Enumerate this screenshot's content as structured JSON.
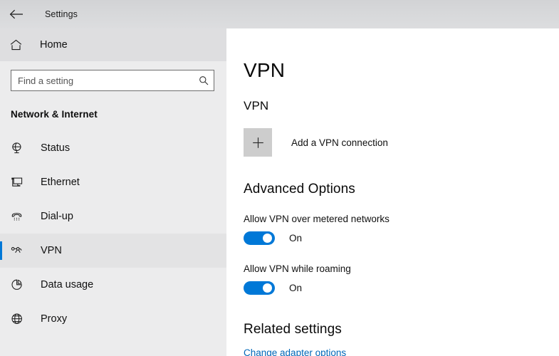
{
  "window": {
    "title": "Settings",
    "back_icon": "back-arrow-icon"
  },
  "sidebar": {
    "home": {
      "label": "Home",
      "icon": "home-icon"
    },
    "search": {
      "placeholder": "Find a setting",
      "value": "",
      "icon": "search-icon"
    },
    "category": "Network & Internet",
    "items": [
      {
        "label": "Status",
        "icon": "network-status-icon",
        "selected": false
      },
      {
        "label": "Ethernet",
        "icon": "ethernet-icon",
        "selected": false
      },
      {
        "label": "Dial-up",
        "icon": "dialup-phone-icon",
        "selected": false
      },
      {
        "label": "VPN",
        "icon": "vpn-icon",
        "selected": true
      },
      {
        "label": "Data usage",
        "icon": "pie-chart-icon",
        "selected": false
      },
      {
        "label": "Proxy",
        "icon": "globe-icon",
        "selected": false
      }
    ]
  },
  "main": {
    "page_title": "VPN",
    "vpn_section": {
      "header": "VPN",
      "add_connection_label": "Add a VPN connection",
      "add_icon": "plus-icon"
    },
    "advanced_options": {
      "header": "Advanced Options",
      "toggles": [
        {
          "label": "Allow VPN over metered networks",
          "state": "On",
          "on": true
        },
        {
          "label": "Allow VPN while roaming",
          "state": "On",
          "on": true
        }
      ]
    },
    "related_settings": {
      "header": "Related settings",
      "links": [
        {
          "label": "Change adapter options"
        }
      ]
    }
  },
  "colors": {
    "accent": "#0078d7",
    "link": "#0067b8",
    "sidebar_bg": "#ececed",
    "titlebar_bg": "#d7d8da"
  }
}
